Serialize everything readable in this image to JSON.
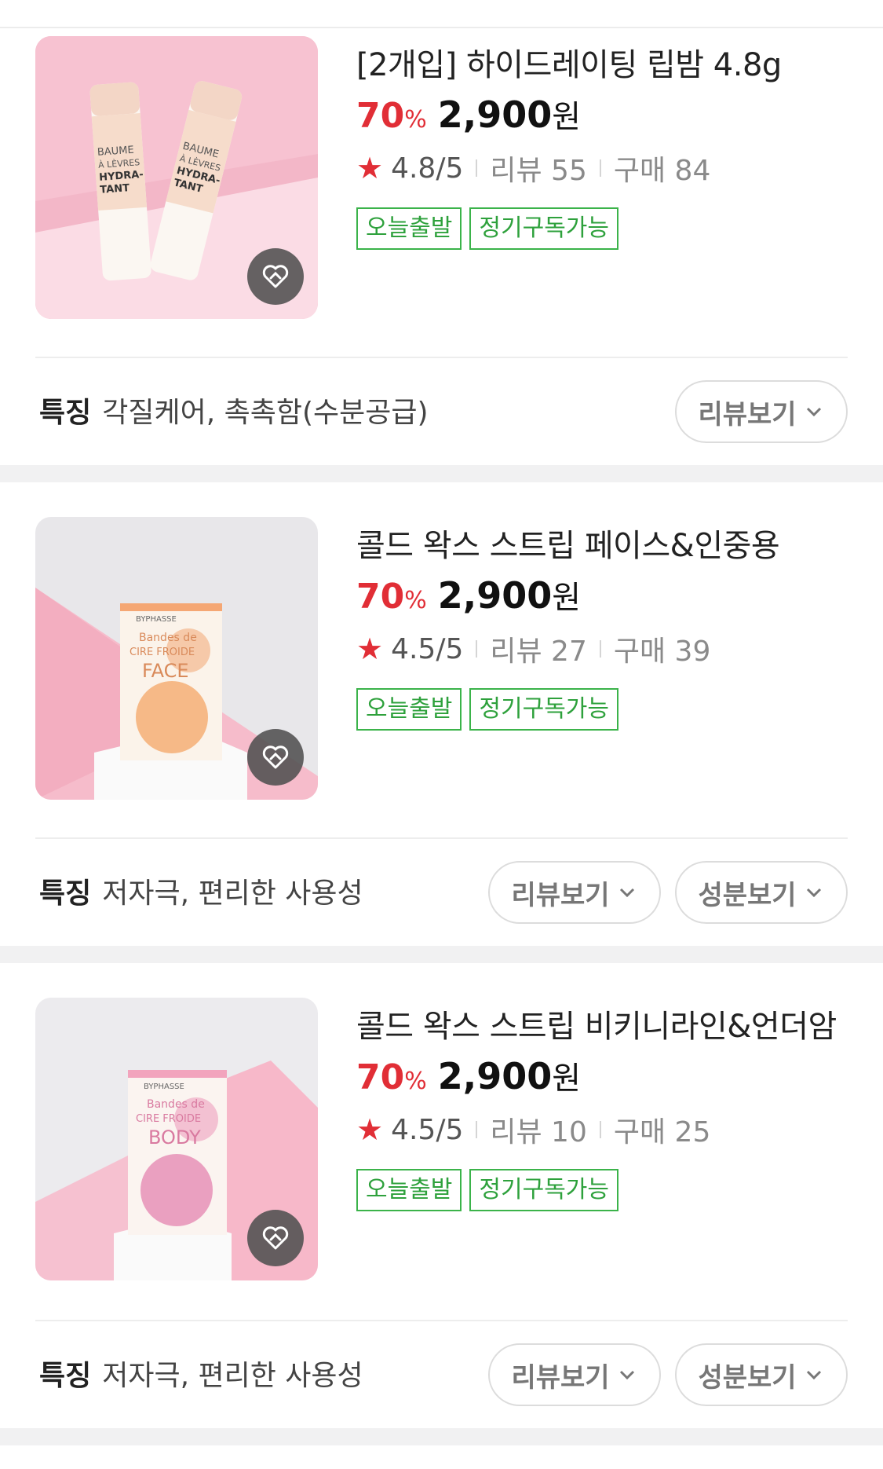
{
  "products": [
    {
      "title": "[2개입] 하이드레이팅 립밤 4.8g",
      "discount": "70",
      "percent_sign": "%",
      "price": "2,900",
      "currency": "원",
      "rating": "4.8/5",
      "reviews": "리뷰 55",
      "purchases": "구매 84",
      "badges": [
        "오늘출발",
        "정기구독가능"
      ],
      "feature_label": "특징",
      "feature_text": "각질케어, 촉촉함(수분공급)",
      "buttons": [
        "리뷰보기"
      ],
      "image_text": [
        "BAUME",
        "À LÈVRES",
        "HYDRA-",
        "TANT"
      ]
    },
    {
      "title": "콜드 왁스 스트립 페이스&인중용",
      "discount": "70",
      "percent_sign": "%",
      "price": "2,900",
      "currency": "원",
      "rating": "4.5/5",
      "reviews": "리뷰 27",
      "purchases": "구매 39",
      "badges": [
        "오늘출발",
        "정기구독가능"
      ],
      "feature_label": "특징",
      "feature_text": "저자극, 편리한 사용성",
      "buttons": [
        "리뷰보기",
        "성분보기"
      ],
      "image_text": [
        "BYPHASSE",
        "Bandes de",
        "CIRE FROIDE",
        "FACE"
      ]
    },
    {
      "title": "콜드 왁스 스트립 비키니라인&언더암",
      "discount": "70",
      "percent_sign": "%",
      "price": "2,900",
      "currency": "원",
      "rating": "4.5/5",
      "reviews": "리뷰 10",
      "purchases": "구매 25",
      "badges": [
        "오늘출발",
        "정기구독가능"
      ],
      "feature_label": "특징",
      "feature_text": "저자극, 편리한 사용성",
      "buttons": [
        "리뷰보기",
        "성분보기"
      ],
      "image_text": [
        "BYPHASSE",
        "Bandes de",
        "CIRE FROIDE",
        "BODY"
      ]
    }
  ],
  "colors": {
    "accent": "#e12e36",
    "badge_green": "#3bb34a",
    "separator": "#f1f1f2"
  }
}
